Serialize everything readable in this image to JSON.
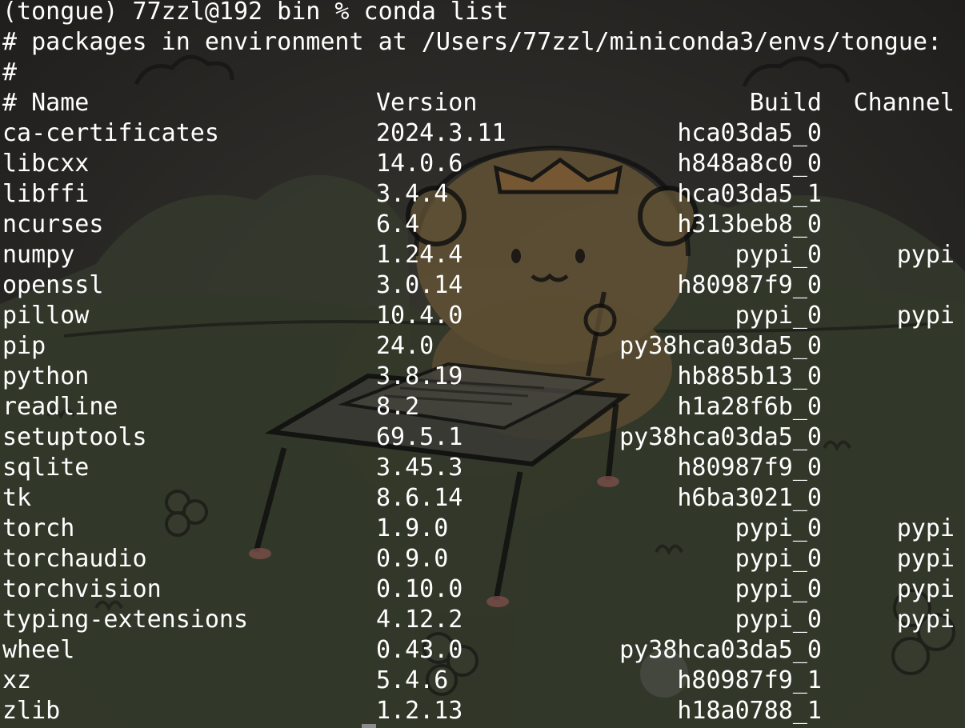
{
  "terminal": {
    "prompt": "(tongue) 77zzl@192 bin % conda list",
    "comment_env": "# packages in environment at /Users/77zzl/miniconda3/envs/tongue:",
    "comment_blank": "#",
    "headers": {
      "name": "# Name",
      "version": "Version",
      "build": "Build",
      "channel": "Channel"
    },
    "packages": [
      {
        "name": "ca-certificates",
        "version": "2024.3.11",
        "build": "hca03da5_0",
        "channel": ""
      },
      {
        "name": "libcxx",
        "version": "14.0.6",
        "build": "h848a8c0_0",
        "channel": ""
      },
      {
        "name": "libffi",
        "version": "3.4.4",
        "build": "hca03da5_1",
        "channel": ""
      },
      {
        "name": "ncurses",
        "version": "6.4",
        "build": "h313beb8_0",
        "channel": ""
      },
      {
        "name": "numpy",
        "version": "1.24.4",
        "build": "pypi_0",
        "channel": "pypi"
      },
      {
        "name": "openssl",
        "version": "3.0.14",
        "build": "h80987f9_0",
        "channel": ""
      },
      {
        "name": "pillow",
        "version": "10.4.0",
        "build": "pypi_0",
        "channel": "pypi"
      },
      {
        "name": "pip",
        "version": "24.0",
        "build": "py38hca03da5_0",
        "channel": ""
      },
      {
        "name": "python",
        "version": "3.8.19",
        "build": "hb885b13_0",
        "channel": ""
      },
      {
        "name": "readline",
        "version": "8.2",
        "build": "h1a28f6b_0",
        "channel": ""
      },
      {
        "name": "setuptools",
        "version": "69.5.1",
        "build": "py38hca03da5_0",
        "channel": ""
      },
      {
        "name": "sqlite",
        "version": "3.45.3",
        "build": "h80987f9_0",
        "channel": ""
      },
      {
        "name": "tk",
        "version": "8.6.14",
        "build": "h6ba3021_0",
        "channel": ""
      },
      {
        "name": "torch",
        "version": "1.9.0",
        "build": "pypi_0",
        "channel": "pypi"
      },
      {
        "name": "torchaudio",
        "version": "0.9.0",
        "build": "pypi_0",
        "channel": "pypi"
      },
      {
        "name": "torchvision",
        "version": "0.10.0",
        "build": "pypi_0",
        "channel": "pypi"
      },
      {
        "name": "typing-extensions",
        "version": "4.12.2",
        "build": "pypi_0",
        "channel": "pypi"
      },
      {
        "name": "wheel",
        "version": "0.43.0",
        "build": "py38hca03da5_0",
        "channel": ""
      },
      {
        "name": "xz",
        "version": "5.4.6",
        "build": "h80987f9_1",
        "channel": ""
      },
      {
        "name": "zlib",
        "version": "1.2.13",
        "build": "h18a0788_1",
        "channel": ""
      }
    ]
  },
  "colors": {
    "text": "#ffffff",
    "background": "#2a2926",
    "wallpaper_bear": "#6b5a3a",
    "wallpaper_hills": "#3b4132"
  },
  "icons": {
    "wallpaper": "bear-at-desk-illustration"
  }
}
